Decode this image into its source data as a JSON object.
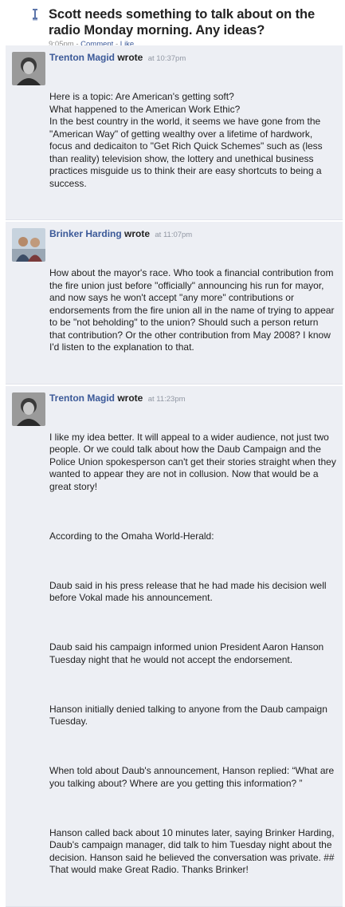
{
  "status": {
    "text": "Scott needs something to talk about on the radio Monday morning. Any ideas?",
    "time": "9:05pm",
    "sep1": "-",
    "comment_label": "Comment",
    "sep2": "-",
    "like_label": "Like"
  },
  "comments": [
    {
      "author": "Trenton Magid",
      "wrote": "wrote",
      "time": "at 10:37pm",
      "paragraphs": [
        "Here is a topic: Are American's getting soft?\nWhat happened to the American Work Ethic?\nIn the best country in the world, it seems we have gone from the \"American Way\" of getting wealthy over a lifetime of hardwork, focus and dedicaiton to \"Get Rich Quick Schemes\" such as (less than reality) television show, the lottery and unethical business practices misguide us to think their are easy shortcuts to being a success."
      ]
    },
    {
      "author": "Brinker Harding",
      "wrote": "wrote",
      "time": "at 11:07pm",
      "paragraphs": [
        "How about the mayor's race. Who took a financial contribution from the fire union just before \"officially\" announcing his run for mayor, and now says he won't accept \"any more\" contributions or endorsements from the fire union all in the name of trying to appear to be \"not beholding\" to the union? Should such a person return that contribution? Or the other contribution from May 2008? I know I'd listen to the explanation to that."
      ]
    },
    {
      "author": "Trenton Magid",
      "wrote": "wrote",
      "time": "at 11:23pm",
      "paragraphs": [
        "I like my idea better. It will appeal to a wider audience, not just two people. Or we could talk about how the Daub Campaign and the Police Union spokesperson can't get their stories straight when they wanted to appear they are not in collusion. Now that would be a great story!",
        "According to the Omaha World-Herald:",
        "Daub said in his press release that he had made his decision well before Vokal made his announcement.",
        "Daub said his campaign informed union President Aaron Hanson Tuesday night that he would not accept the endorsement.",
        "Hanson initially denied talking to anyone from the Daub campaign Tuesday.",
        "When told about Daub's announcement, Hanson replied: “What are you talking about? Where are you getting this information? ”",
        "Hanson called back about 10 minutes later, saying Brinker Harding, Daub's campaign manager, did talk to him Tuesday night about the decision. Hanson said he believed the conversation was private. ## That would make Great Radio. Thanks Brinker!"
      ]
    }
  ]
}
